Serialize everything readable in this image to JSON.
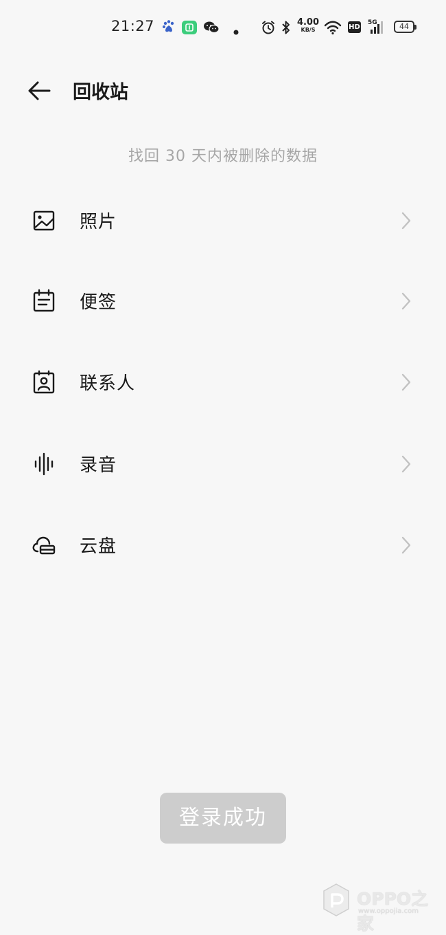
{
  "status_bar": {
    "time": "21:27",
    "net_speed_value": "4.00",
    "net_speed_unit": "KB/S",
    "hd_label": "HD",
    "signal_label": "5G",
    "battery_level": "44",
    "icons": [
      "baidu-icon",
      "green-app-icon",
      "wechat-icon",
      "dot-icon",
      "alarm-icon",
      "bluetooth-icon",
      "wifi-icon",
      "signal-icon",
      "battery-icon"
    ],
    "colors": {
      "green_app": "#3ccd7c",
      "baidu": "#3a63c9"
    }
  },
  "header": {
    "back_icon": "arrow-left-icon",
    "title": "回收站"
  },
  "subtitle": "找回 30 天内被删除的数据",
  "items": [
    {
      "label": "照片",
      "icon": "image-icon"
    },
    {
      "label": "便签",
      "icon": "note-icon"
    },
    {
      "label": "联系人",
      "icon": "contact-icon"
    },
    {
      "label": "录音",
      "icon": "waveform-icon"
    },
    {
      "label": "云盘",
      "icon": "cloud-drive-icon"
    }
  ],
  "toast": "登录成功",
  "watermark": {
    "brand": "OPPO之家",
    "url": "www.oppojia.com"
  }
}
